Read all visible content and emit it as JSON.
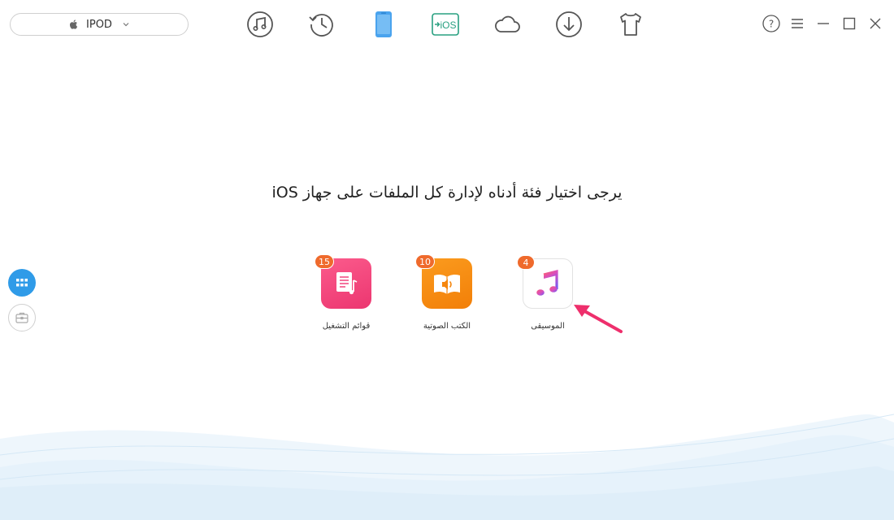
{
  "device": {
    "name": "IPOD",
    "icon": "apple-icon"
  },
  "toolbar": [
    {
      "name": "music-icon"
    },
    {
      "name": "history-icon"
    },
    {
      "name": "device-icon"
    },
    {
      "name": "ios-mover-icon",
      "text": "iOS"
    },
    {
      "name": "cloud-icon"
    },
    {
      "name": "download-icon"
    },
    {
      "name": "tshirt-icon"
    }
  ],
  "window": {
    "help": "help-icon",
    "menu": "menu-icon",
    "minimize": "minimize-icon",
    "maximize": "maximize-icon",
    "close": "close-icon"
  },
  "sidebar": [
    {
      "name": "grid-icon",
      "active": true
    },
    {
      "name": "toolbox-icon",
      "active": false
    }
  ],
  "heading": "يرجى اختيار فئة أدناه لإدارة كل الملفات على جهاز iOS",
  "categories": [
    {
      "label": "قوائم التشغيل",
      "count": "15",
      "icon": "playlist-icon",
      "color": "#f2457e"
    },
    {
      "label": "الكتب الصوتية",
      "count": "10",
      "icon": "audiobook-icon",
      "color": "#f5870f"
    },
    {
      "label": "الموسيقى",
      "count": "4",
      "icon": "music-note-icon",
      "color": "#ffffff"
    }
  ],
  "colors": {
    "accent": "#2f9be8",
    "badge": "#ef6a2c",
    "arrow": "#ee2f6c"
  }
}
